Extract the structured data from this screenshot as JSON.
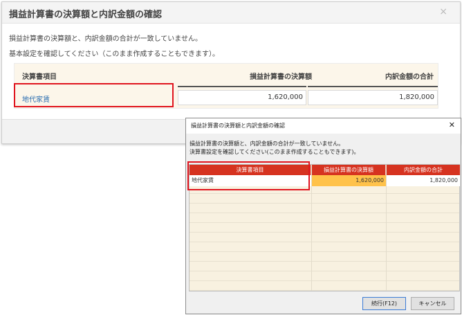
{
  "web_dialog": {
    "title": "損益計算書の決算額と内訳金額の確認",
    "close_glyph": "×",
    "message_line1": "損益計算書の決算額と、内訳金額の合計が一致していません。",
    "message_line2": "基本設定を確認してください（このまま作成することもできます）。",
    "table": {
      "headers": [
        "決算書項目",
        "損益計算書の決算額",
        "内訳金額の合計"
      ],
      "rows": [
        {
          "item": "地代家賃",
          "settlement_amount": "1,620,000",
          "breakdown_total": "1,820,000"
        }
      ]
    }
  },
  "win_dialog": {
    "title": "損益計算書の決算額と内訳金額の確認",
    "close_glyph": "✕",
    "message_line1": "損益計算書の決算額と、内訳金額の合計が一致していません。",
    "message_line2": "決算書設定を確認してください(このまま作成することもできます)。",
    "grid": {
      "headers": [
        "決算書項目",
        "損益計算書の決算額",
        "内訳金額の合計"
      ],
      "rows": [
        {
          "item": "地代家賃",
          "settlement_amount": "1,620,000",
          "breakdown_total": "1,820,000"
        }
      ]
    },
    "buttons": {
      "continue_label": "続行(F12)",
      "cancel_label": "キャンセル"
    }
  },
  "colors": {
    "highlight_red": "#e0141e",
    "grid_header": "#d63320",
    "mismatch_cell": "#ffc24a",
    "link": "#2a6db0"
  }
}
